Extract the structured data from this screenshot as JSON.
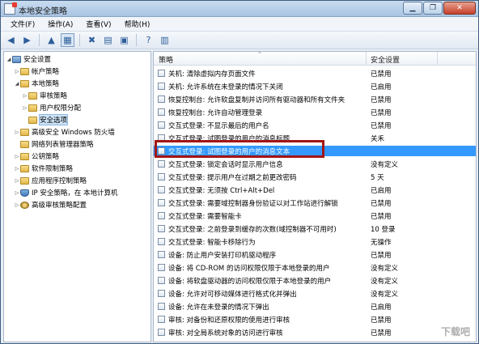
{
  "window": {
    "title": "本地安全策略",
    "min": "▁",
    "restore": "❐",
    "close": "✕"
  },
  "menu": [
    {
      "label": "文件(F)"
    },
    {
      "label": "操作(A)"
    },
    {
      "label": "查看(V)"
    },
    {
      "label": "帮助(H)"
    }
  ],
  "tree": [
    {
      "label": "安全设置",
      "indent": 0,
      "exp": "◢",
      "icon": "root"
    },
    {
      "label": "帐户策略",
      "indent": 1,
      "exp": "▷",
      "icon": "folder"
    },
    {
      "label": "本地策略",
      "indent": 1,
      "exp": "◢",
      "icon": "folder"
    },
    {
      "label": "审核策略",
      "indent": 2,
      "exp": "▷",
      "icon": "folder"
    },
    {
      "label": "用户权限分配",
      "indent": 2,
      "exp": "▷",
      "icon": "folder"
    },
    {
      "label": "安全选项",
      "indent": 2,
      "exp": "",
      "icon": "folder",
      "selected": true
    },
    {
      "label": "高级安全 Windows 防火墙",
      "indent": 1,
      "exp": "▷",
      "icon": "folder"
    },
    {
      "label": "网络列表管理器策略",
      "indent": 1,
      "exp": "",
      "icon": "folder"
    },
    {
      "label": "公钥策略",
      "indent": 1,
      "exp": "▷",
      "icon": "folder"
    },
    {
      "label": "软件限制策略",
      "indent": 1,
      "exp": "▷",
      "icon": "folder"
    },
    {
      "label": "应用程序控制策略",
      "indent": 1,
      "exp": "▷",
      "icon": "folder"
    },
    {
      "label": "IP 安全策略，在 本地计算机",
      "indent": 1,
      "exp": "▷",
      "icon": "shield"
    },
    {
      "label": "高级审核策略配置",
      "indent": 1,
      "exp": "▷",
      "icon": "gear"
    }
  ],
  "list": {
    "col_policy": "策略",
    "col_setting": "安全设置",
    "rows": [
      {
        "name": "关机: 清除虚拟内存页面文件",
        "value": "已禁用"
      },
      {
        "name": "关机: 允许系统在未登录的情况下关闭",
        "value": "已启用"
      },
      {
        "name": "恢复控制台: 允许软盘复制并访问所有驱动器和所有文件夹",
        "value": "已禁用"
      },
      {
        "name": "恢复控制台: 允许自动管理登录",
        "value": "已禁用"
      },
      {
        "name": "交互式登录: 不显示最后的用户名",
        "value": "已禁用"
      },
      {
        "name": "交互式登录: 试图登录的用户的消息标题",
        "value": "关禾"
      },
      {
        "name": "交互式登录: 试图登录的用户的消息文本",
        "value": "",
        "highlight": true
      },
      {
        "name": "交互式登录: 锁定会话时显示用户信息",
        "value": "没有定义"
      },
      {
        "name": "交互式登录: 提示用户在过期之前更改密码",
        "value": "5 天"
      },
      {
        "name": "交互式登录: 无须按 Ctrl+Alt+Del",
        "value": "已启用"
      },
      {
        "name": "交互式登录: 需要域控制器身份验证以对工作站进行解锁",
        "value": "已禁用"
      },
      {
        "name": "交互式登录: 需要智能卡",
        "value": "已禁用"
      },
      {
        "name": "交互式登录: 之前登录到缓存的次数(域控制器不可用时)",
        "value": "10 登录"
      },
      {
        "name": "交互式登录: 智能卡移除行为",
        "value": "无操作"
      },
      {
        "name": "设备: 防止用户安装打印机驱动程序",
        "value": "已禁用"
      },
      {
        "name": "设备: 将 CD-ROM 的访问权限仅限于本地登录的用户",
        "value": "没有定义"
      },
      {
        "name": "设备: 将软盘驱动器的访问权限仅限于本地登录的用户",
        "value": "没有定义"
      },
      {
        "name": "设备: 允许对可移动媒体进行格式化并弹出",
        "value": "没有定义"
      },
      {
        "name": "设备: 允许在未登录的情况下弹出",
        "value": "已启用"
      },
      {
        "name": "审核: 对备份和还原权限的使用进行审核",
        "value": "已禁用"
      },
      {
        "name": "审核: 对全局系统对象的访问进行审核",
        "value": "已禁用"
      }
    ]
  },
  "watermark": "下载吧"
}
